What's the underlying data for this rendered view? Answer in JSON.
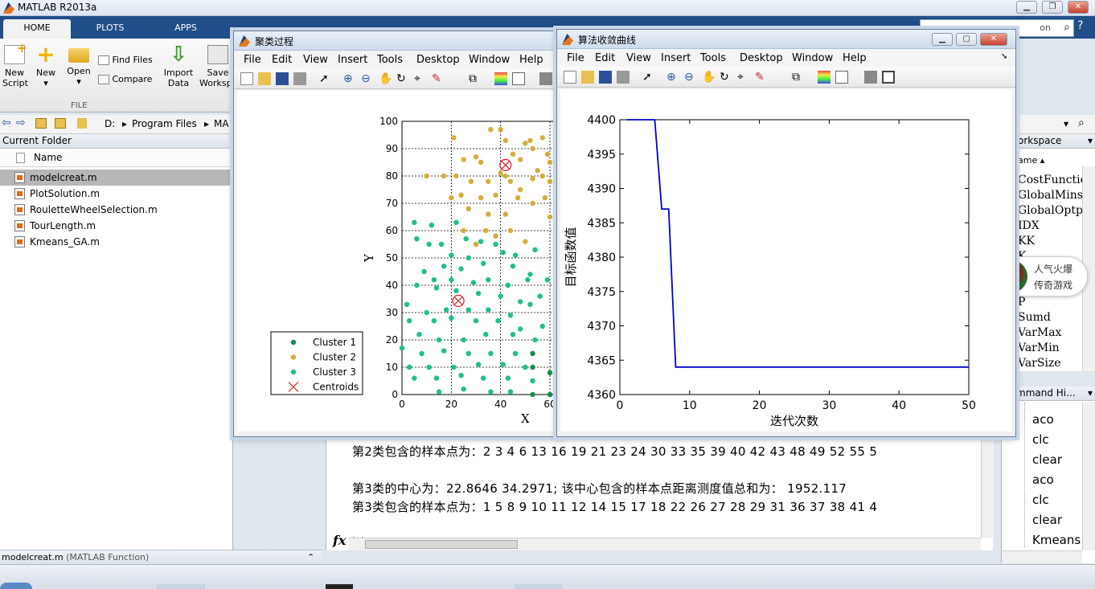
{
  "app": {
    "title": "MATLAB R2013a"
  },
  "tabs": [
    "HOME",
    "PLOTS",
    "APPS"
  ],
  "ribbon": {
    "new_script": [
      "New",
      "Script"
    ],
    "new": "New",
    "open": "Open",
    "find_files": "Find Files",
    "compare": "Compare",
    "import_data": [
      "Import",
      "Data"
    ],
    "save_workspace": [
      "Save",
      "Workspa"
    ],
    "section": "FILE"
  },
  "search": {
    "placeholder": "on"
  },
  "path": {
    "parts": [
      "D:",
      "Program Files",
      "MA"
    ]
  },
  "current_folder": {
    "title": "Current Folder",
    "column": "Name",
    "files": [
      "modelcreat.m",
      "PlotSolution.m",
      "RouletteWheelSelection.m",
      "TourLength.m",
      "Kmeans_GA.m"
    ],
    "detail": "modelcreat.m",
    "detail_type": "(MATLAB Function)"
  },
  "workspace": {
    "title": "orkspace",
    "column": "ame",
    "items": [
      "CostFunction",
      "GlobalMins",
      "GlobalOptpo",
      "IDX",
      "KK",
      "K",
      "P",
      "Sumd",
      "VarMax",
      "VarMin",
      "VarSize"
    ]
  },
  "command_history": {
    "title": "mmand Hi...",
    "items": [
      "aco",
      "clc",
      "clear",
      "aco",
      "clc",
      "clear",
      "Kmeans"
    ]
  },
  "command_window": {
    "lines": [
      "第2类包含的样本点为：2   3   4   6  13  16  19  21  23  24  30  33  35  39  40  42  43  48  49  52  55  5",
      "第3类的中心为：22.8646      34.2971;       该中心包含的样本点距离测度值总和为：  1952.117",
      "第3类包含的样本点为：1   5   8   9  10  11  12  14  15  17  18  22  26  27  28  29  31  36  37  38  41  4"
    ],
    "prompt": ">>",
    "fx": "fx"
  },
  "popup": {
    "line1": "人气火爆",
    "line2": "传奇游戏"
  },
  "figure1": {
    "title": "聚类过程"
  },
  "figure2": {
    "title": "算法收敛曲线"
  },
  "menus": [
    "File",
    "Edit",
    "View",
    "Insert",
    "Tools",
    "Desktop",
    "Window",
    "Help"
  ],
  "colors": {
    "cluster1": "#1b8a4c",
    "cluster2": "#d4ae3a",
    "cluster3": "#1ebf8a",
    "centroid": "#e02020",
    "line": "#0000cc"
  },
  "chart_data": [
    {
      "type": "scatter",
      "xlabel": "X",
      "ylabel": "Y",
      "xlim": [
        0,
        60
      ],
      "ylim": [
        0,
        100
      ],
      "xticks": [
        0,
        20,
        40,
        60
      ],
      "yticks": [
        0,
        10,
        20,
        30,
        40,
        50,
        60,
        70,
        80,
        90,
        100
      ],
      "grid": true,
      "legend_position": "bottom-left",
      "series": [
        {
          "name": "Cluster 1",
          "points": [
            [
              53,
              15
            ],
            [
              53,
              10
            ],
            [
              60,
              8
            ],
            [
              63,
              25
            ],
            [
              53,
              0
            ],
            [
              60,
              0
            ]
          ]
        },
        {
          "name": "Cluster 2",
          "points": [
            [
              21,
              94
            ],
            [
              36,
              97
            ],
            [
              40,
              97
            ],
            [
              42,
              93
            ],
            [
              50,
              92
            ],
            [
              52,
              93
            ],
            [
              53,
              90
            ],
            [
              57,
              94
            ],
            [
              59,
              88
            ],
            [
              25,
              86
            ],
            [
              30,
              87
            ],
            [
              32,
              85
            ],
            [
              45,
              88
            ],
            [
              48,
              86
            ],
            [
              55,
              82
            ],
            [
              40,
              81
            ],
            [
              42,
              80
            ],
            [
              60,
              85
            ],
            [
              10,
              80
            ],
            [
              17,
              80
            ],
            [
              22,
              80
            ],
            [
              28,
              78
            ],
            [
              35,
              78
            ],
            [
              44,
              78
            ],
            [
              48,
              75
            ],
            [
              53,
              79
            ],
            [
              57,
              80
            ],
            [
              60,
              78
            ],
            [
              20,
              72
            ],
            [
              24,
              73
            ],
            [
              32,
              72
            ],
            [
              38,
              73
            ],
            [
              47,
              72
            ],
            [
              53,
              70
            ],
            [
              58,
              72
            ],
            [
              27,
              68
            ],
            [
              35,
              66
            ],
            [
              42,
              66
            ],
            [
              60,
              65
            ],
            [
              25,
              60
            ],
            [
              34,
              60
            ],
            [
              44,
              60
            ],
            [
              38,
              58
            ],
            [
              30,
              55
            ],
            [
              50,
              56
            ]
          ]
        },
        {
          "name": "Cluster 3",
          "points": [
            [
              5,
              63
            ],
            [
              12,
              62
            ],
            [
              22,
              63
            ],
            [
              6,
              57
            ],
            [
              16,
              55
            ],
            [
              11,
              55
            ],
            [
              26,
              57
            ],
            [
              32,
              56
            ],
            [
              38,
              55
            ],
            [
              41,
              52
            ],
            [
              46,
              51
            ],
            [
              54,
              53
            ],
            [
              20,
              51
            ],
            [
              27,
              50
            ],
            [
              33,
              48
            ],
            [
              17,
              47
            ],
            [
              24,
              46
            ],
            [
              45,
              47
            ],
            [
              52,
              44
            ],
            [
              9,
              45
            ],
            [
              13,
              42
            ],
            [
              20,
              42
            ],
            [
              29,
              41
            ],
            [
              35,
              42
            ],
            [
              43,
              40
            ],
            [
              51,
              42
            ],
            [
              59,
              42
            ],
            [
              6,
              40
            ],
            [
              14,
              39
            ],
            [
              22,
              38
            ],
            [
              31,
              37
            ],
            [
              40,
              36
            ],
            [
              48,
              34
            ],
            [
              56,
              36
            ],
            [
              2,
              33
            ],
            [
              10,
              30
            ],
            [
              18,
              31
            ],
            [
              27,
              31
            ],
            [
              35,
              31
            ],
            [
              44,
              29
            ],
            [
              52,
              33
            ],
            [
              3,
              27
            ],
            [
              13,
              27
            ],
            [
              20,
              28
            ],
            [
              30,
              27
            ],
            [
              39,
              27
            ],
            [
              48,
              24
            ],
            [
              57,
              25
            ],
            [
              7,
              22
            ],
            [
              15,
              20
            ],
            [
              25,
              20
            ],
            [
              34,
              22
            ],
            [
              45,
              22
            ],
            [
              54,
              20
            ],
            [
              0,
              17
            ],
            [
              8,
              15
            ],
            [
              17,
              16
            ],
            [
              27,
              15
            ],
            [
              36,
              15
            ],
            [
              46,
              15
            ],
            [
              3,
              10
            ],
            [
              11,
              10
            ],
            [
              21,
              10
            ],
            [
              31,
              11
            ],
            [
              41,
              11
            ],
            [
              50,
              10
            ],
            [
              5,
              6
            ],
            [
              14,
              6
            ],
            [
              24,
              7
            ],
            [
              33,
              6
            ],
            [
              43,
              6
            ],
            [
              53,
              5
            ],
            [
              15,
              1
            ],
            [
              25,
              2
            ],
            [
              36,
              1
            ],
            [
              44,
              1
            ]
          ]
        },
        {
          "name": "Centroids",
          "points": [
            [
              42,
              84
            ],
            [
              22.86,
              34.3
            ]
          ]
        }
      ]
    },
    {
      "type": "line",
      "xlabel": "迭代次数",
      "ylabel": "目标函数值",
      "xlim": [
        0,
        50
      ],
      "ylim": [
        4360,
        4400
      ],
      "xticks": [
        0,
        10,
        20,
        30,
        40,
        50
      ],
      "yticks": [
        4360,
        4365,
        4370,
        4375,
        4380,
        4385,
        4390,
        4395,
        4400
      ],
      "grid": false,
      "series": [
        {
          "points": [
            [
              1,
              4400
            ],
            [
              5,
              4400
            ],
            [
              6,
              4387
            ],
            [
              7,
              4387
            ],
            [
              8,
              4364
            ],
            [
              50,
              4364
            ]
          ]
        }
      ]
    }
  ]
}
